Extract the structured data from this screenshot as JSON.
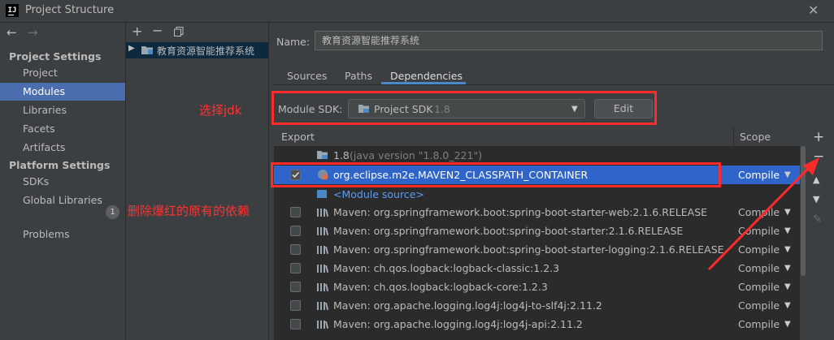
{
  "window": {
    "title": "Project Structure",
    "app_icon": "IJ"
  },
  "sidebar": {
    "project_settings_header": "Project Settings",
    "project_items": [
      "Project",
      "Modules",
      "Libraries",
      "Facets",
      "Artifacts"
    ],
    "platform_settings_header": "Platform Settings",
    "platform_items": [
      "SDKs",
      "Global Libraries"
    ],
    "problems_label": "Problems",
    "problems_count": "1",
    "selected": "Modules"
  },
  "modules": {
    "module_name": "教育资源智能推荐系统"
  },
  "detail": {
    "name_label": "Name:",
    "name_value": "教育资源智能推荐系统",
    "tabs": [
      "Sources",
      "Paths",
      "Dependencies"
    ],
    "active_tab": "Dependencies",
    "module_sdk_label": "Module SDK:",
    "sdk_value": "Project SDK",
    "sdk_version": "1.8",
    "edit_label": "Edit"
  },
  "table": {
    "col_export": "Export",
    "col_scope": "Scope",
    "jdk_name": "1.8",
    "jdk_detail": "(java version \"1.8.0_221\")",
    "selected_row": "org.eclipse.m2e.MAVEN2_CLASSPATH_CONTAINER",
    "selected_scope": "Compile",
    "module_source": "<Module source>",
    "rows": [
      {
        "name": "Maven: org.springframework.boot:spring-boot-starter-web:2.1.6.RELEASE",
        "scope": "Compile"
      },
      {
        "name": "Maven: org.springframework.boot:spring-boot-starter:2.1.6.RELEASE",
        "scope": "Compile"
      },
      {
        "name": "Maven: org.springframework.boot:spring-boot-starter-logging:2.1.6.RELEASE",
        "scope": "Compile"
      },
      {
        "name": "Maven: ch.qos.logback:logback-classic:1.2.3",
        "scope": "Compile"
      },
      {
        "name": "Maven: ch.qos.logback:logback-core:1.2.3",
        "scope": "Compile"
      },
      {
        "name": "Maven: org.apache.logging.log4j:log4j-to-slf4j:2.11.2",
        "scope": "Compile"
      },
      {
        "name": "Maven: org.apache.logging.log4j:log4j-api:2.11.2",
        "scope": "Compile"
      }
    ]
  },
  "annotations": {
    "select_jdk": "选择jdk",
    "delete_red": "删除爆红的原有的依赖"
  },
  "colors": {
    "selection": "#4b6eaf",
    "row_selection": "#2f65ca",
    "annotation": "#ff2a2a",
    "tab_underline": "#4a88c7",
    "background": "#3c3f41"
  }
}
